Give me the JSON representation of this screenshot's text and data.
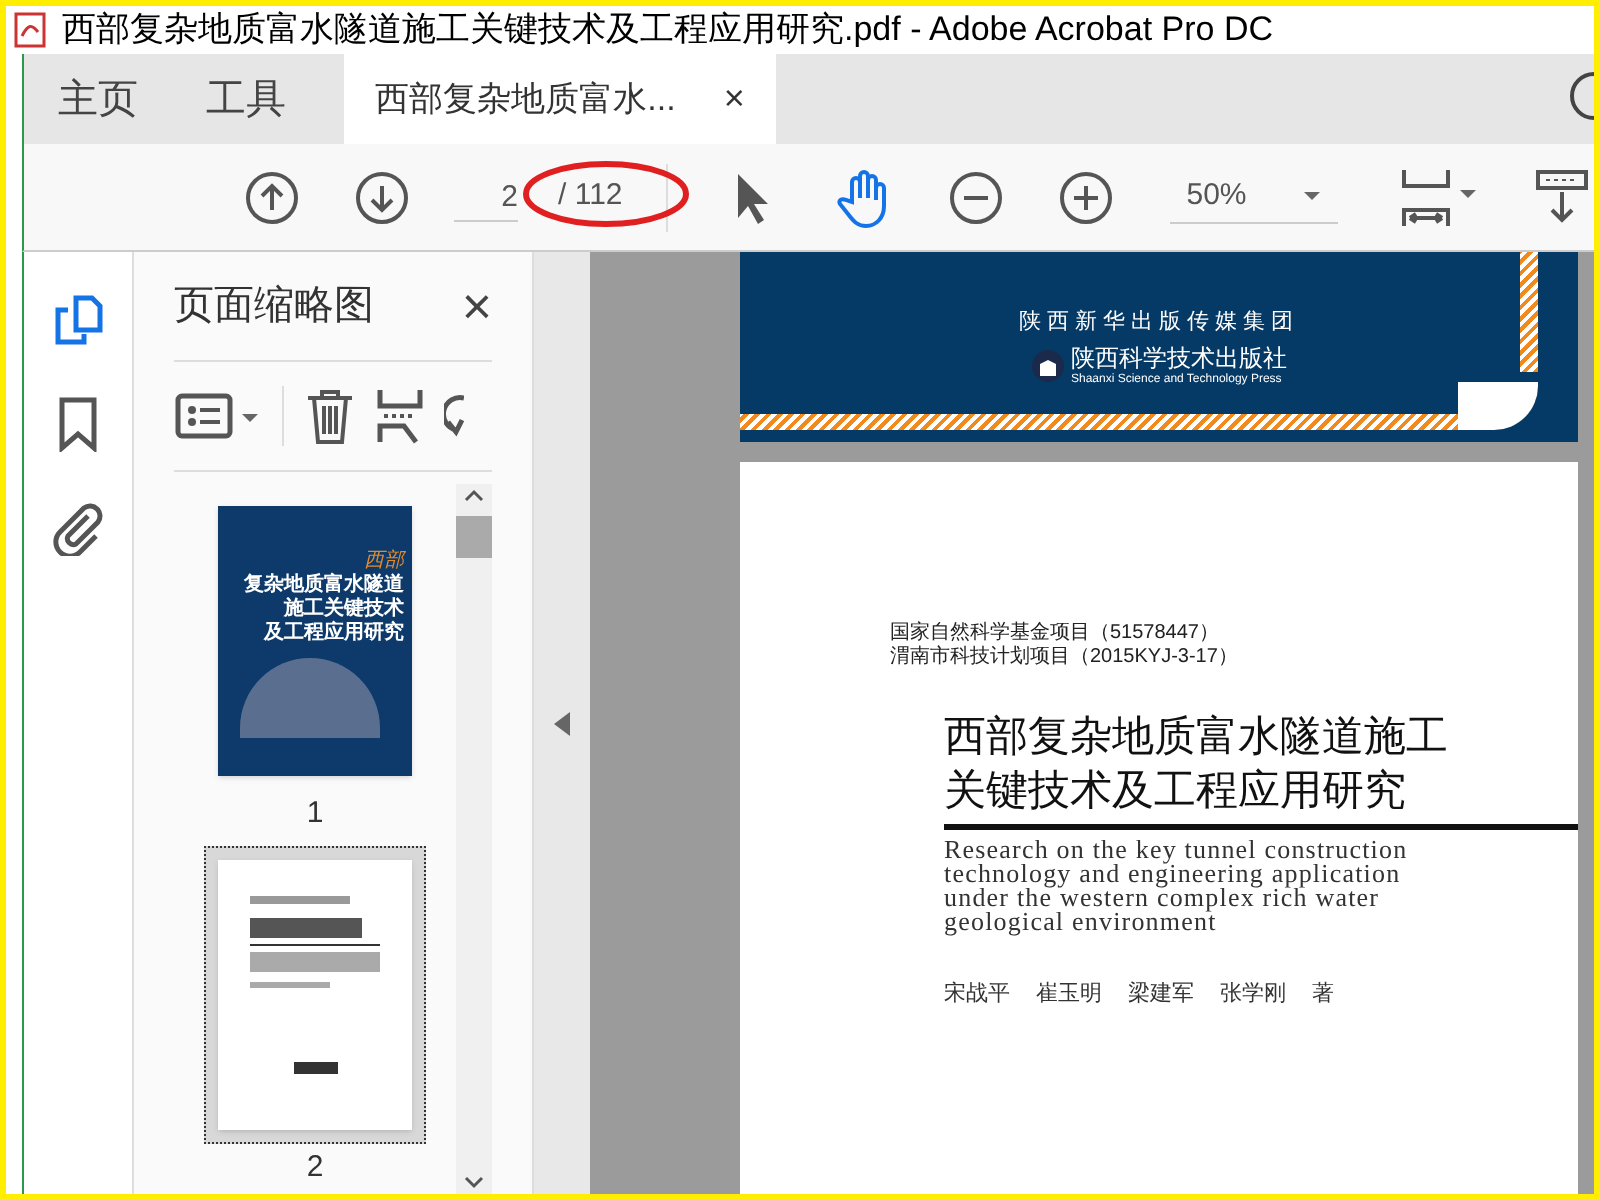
{
  "window": {
    "title": "西部复杂地质富水隧道施工关键技术及工程应用研究.pdf - Adobe Acrobat Pro DC"
  },
  "tabs": [
    {
      "label": "主页",
      "selected": false
    },
    {
      "label": "工具",
      "selected": false
    },
    {
      "label": "西部复杂地质富水...",
      "selected": true,
      "close": "×"
    }
  ],
  "toolbar": {
    "page_input": "2",
    "page_total": "/ 112",
    "zoom": "50%",
    "tools": [
      {
        "kind": "select",
        "selected": false
      },
      {
        "kind": "hand",
        "selected": true
      }
    ]
  },
  "sidebar": {
    "items": [
      {
        "kind": "pages",
        "selected": true
      },
      {
        "kind": "bookmarks",
        "selected": false
      },
      {
        "kind": "attachments",
        "selected": false
      }
    ]
  },
  "thumbnails_panel": {
    "title": "页面缩略图",
    "close": "×",
    "thumbnails": [
      {
        "kind": "cover",
        "label": "1",
        "selected": false,
        "cover_lines": [
          "西部",
          "复杂地质富水隧道",
          "施工关键技术",
          "及工程应用研究"
        ]
      },
      {
        "kind": "text",
        "label": "2",
        "selected": true
      }
    ]
  },
  "document": {
    "page_1": {
      "publisher_group": "陕西新华出版传媒集团",
      "publisher": "陕西科学技术出版社",
      "publisher_en": "Shaanxi Science and Technology Press"
    },
    "page_2": {
      "funding": [
        "国家自然科学基金项目（51578447）",
        "渭南市科技计划项目（2015KYJ-3-17）"
      ],
      "title_lines": [
        "西部复杂地质富水隧道施工",
        "关键技术及工程应用研究"
      ],
      "english_title_lines": [
        "Research on the key tunnel construction",
        "technology and engineering application",
        "under the western complex rich water",
        "geological environment"
      ],
      "authors": [
        "宋战平",
        "崔玉明",
        "梁建军",
        "张学刚"
      ],
      "author_suffix": "著"
    }
  }
}
